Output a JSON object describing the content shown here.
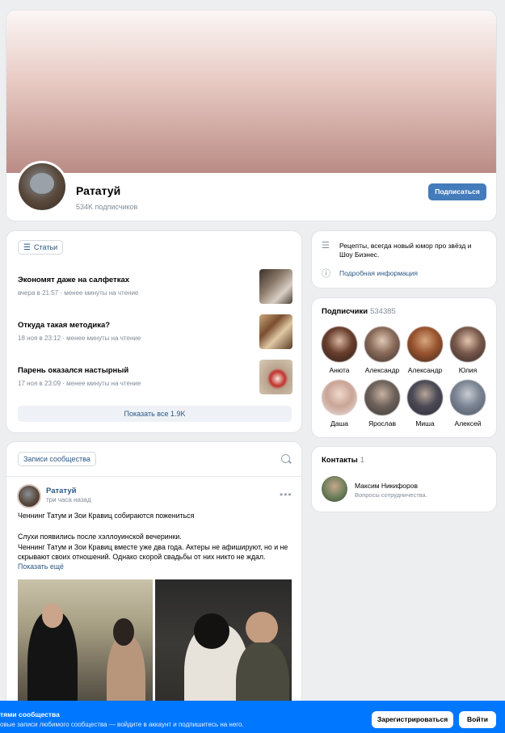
{
  "group": {
    "name": "Рататуй",
    "subscribers": "534K подписчиков",
    "subscribe_label": "Подписаться"
  },
  "articles": {
    "chip_label": "Статьи",
    "items": [
      {
        "title": "Экономят даже на салфетках",
        "meta": "вчера в 21:57 · менее минуты на чтение"
      },
      {
        "title": "Откуда такая методика?",
        "meta": "18 ноя в 23:12 · менее минуты на чтение"
      },
      {
        "title": "Парень оказался настырный",
        "meta": "17 ноя в 23:09 · менее минуты на чтение"
      }
    ],
    "show_all_label": "Показать все 1.9K"
  },
  "info": {
    "description": "Рецепты, всегда новый юмор про звёзд и Шоу Бизнес.",
    "details_link": "Подробная информация"
  },
  "followers": {
    "title": "Подписчики",
    "count": "534385",
    "people": [
      "Анюта",
      "Александр",
      "Александр",
      "Юлия",
      "Даша",
      "Ярослав",
      "Миша",
      "Алексей"
    ]
  },
  "contacts": {
    "title": "Контакты",
    "count": "1",
    "name": "Максим Никифоров",
    "role": "Вопросы сотрудничества."
  },
  "wall": {
    "chip_label": "Записи сообщества",
    "post": {
      "author": "Рататуй",
      "time": "три часа назад",
      "headline": "Ченнинг Татум и Зои Кравиц собираются пожениться",
      "line1": "Слухи появились после хэллоуинской вечеринки.",
      "line2": "Ченнинг Татум и Зои Кравиц вместе уже два года. Актеры не афишируют, но и не",
      "line3": "скрывают своих отношений. Однако скорой свадьбы от них никто не ждал.",
      "show_more": "Показать ещё"
    }
  },
  "bottom_bar": {
    "title": "тями сообщества",
    "subtitle": "овые записи любимого сообщества — войдите в аккаунт и подпишитесь на него.",
    "register_label": "Зарегистрироваться",
    "login_label": "Войти"
  },
  "colors": {
    "accent": "#447bba",
    "link": "#2a5885",
    "bar": "#0077ff"
  }
}
